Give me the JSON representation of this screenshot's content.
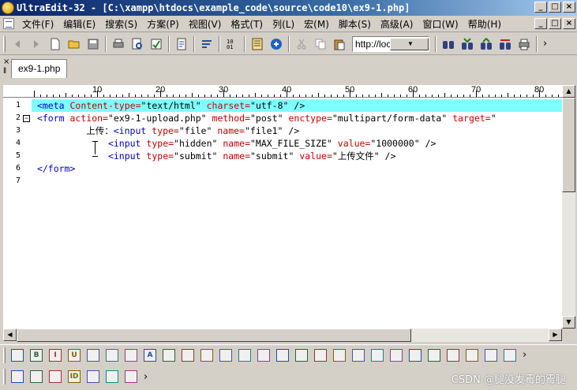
{
  "window": {
    "title": "UltraEdit-32 - [C:\\xampp\\htdocs\\example_code\\source\\code10\\ex9-1.php]",
    "buttons": {
      "minimize": "_",
      "maximize": "□",
      "close": "×"
    }
  },
  "menubar": {
    "items": [
      "文件(F)",
      "编辑(E)",
      "搜索(S)",
      "方案(P)",
      "视图(V)",
      "格式(T)",
      "列(L)",
      "宏(M)",
      "脚本(S)",
      "高级(A)",
      "窗口(W)",
      "帮助(H)"
    ]
  },
  "toolbar": {
    "url_value": "http://localhos",
    "overflow": "›",
    "icons": [
      "back-arrow-icon",
      "forward-arrow-icon",
      "new-file-icon",
      "open-folder-icon",
      "save-icon",
      "print-icon",
      "print-preview-icon",
      "spell-check-icon",
      "document-properties-icon",
      "word-wrap-icon",
      "hex-mode-icon",
      "browser-view-icon",
      "web-browser-icon",
      "cut-icon",
      "copy-icon",
      "paste-icon",
      "find-icon",
      "find-next-icon",
      "find-prev-icon",
      "replace-icon",
      "print-page-icon"
    ]
  },
  "tabs": [
    {
      "label": "ex9-1.php",
      "active": true
    }
  ],
  "ruler": {
    "labels": [
      "10",
      "20",
      "30",
      "40",
      "50",
      "60",
      "70",
      "80"
    ]
  },
  "editor": {
    "lines": [
      {
        "number": "1",
        "text": "<meta Content-type=\"text/html\" charset=\"utf-8\" />",
        "active": true,
        "fold": ""
      },
      {
        "number": "2",
        "text": "<form action=\"ex9-1-upload.php\" method=\"post\" enctype=\"multipart/form-data\" target=\"",
        "active": false,
        "fold": "−"
      },
      {
        "number": "3",
        "text": "         上传：<input type=\"file\" name=\"file1\" />",
        "active": false,
        "fold": ""
      },
      {
        "number": "4",
        "text": "             <input type=\"hidden\" name=\"MAX_FILE_SIZE\" value=\"1000000\" />",
        "active": false,
        "fold": ""
      },
      {
        "number": "5",
        "text": "             <input type=\"submit\" name=\"submit\" value=\"上传文件\" />",
        "active": false,
        "fold": ""
      },
      {
        "number": "6",
        "text": "</form>",
        "active": false,
        "fold": ""
      },
      {
        "number": "7",
        "text": "",
        "active": false,
        "fold": ""
      }
    ]
  },
  "html_toolbar": {
    "icons": [
      "html-tag-icon",
      "bold-icon",
      "italic-icon",
      "underline-icon",
      "align-left-icon",
      "list-icon",
      "numbered-list-icon",
      "font-icon",
      "edit-icon",
      "align-center-icon",
      "align-right-icon",
      "justify-icon",
      "indent-icon",
      "form-icon",
      "input-icon",
      "label-icon",
      "textarea-icon",
      "password-icon",
      "select-icon",
      "checkbox-icon",
      "radio-icon",
      "button-icon",
      "image-icon",
      "anchor-icon",
      "link-icon",
      "special-char-icon",
      "plugin-icon"
    ],
    "overflow": "›"
  },
  "bottom_toolbar": {
    "icons": [
      "table-icon",
      "copy-layer-icon",
      "validate-icon",
      "id-icon",
      "number-icon",
      "ruler-tool-icon",
      "check-icon"
    ],
    "overflow": "›"
  },
  "watermark": "CSDN @腿没发霉的霉腿",
  "colors": {
    "active_line": "#80ffff",
    "tag": "#0000c0",
    "attr": "#c00000",
    "value": "#000000"
  }
}
